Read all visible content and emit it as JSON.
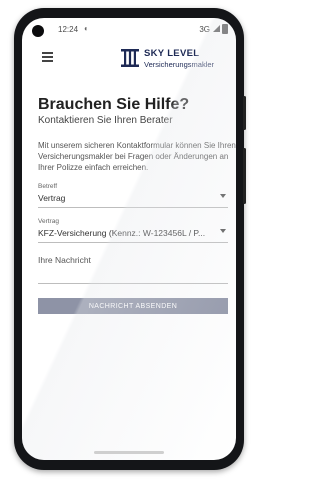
{
  "status_bar": {
    "time": "12:24",
    "network": "3G"
  },
  "header": {
    "brand_name": "SKY LEVEL",
    "brand_tagline": "Versicherungsmakler",
    "menu_icon": "hamburger-menu-icon"
  },
  "main": {
    "title": "Brauchen Sie Hilfe?",
    "subtitle": "Kontaktieren Sie Ihren Berater",
    "intro": "Mit unserem sicheren Kontaktformular können Sie Ihren Versicherungsmakler bei Fragen oder Änderungen an Ihrer Polizze einfach erreichen.",
    "fields": {
      "subject": {
        "label": "Betreff",
        "value": "Vertrag"
      },
      "contract": {
        "label": "Vertrag",
        "value": "KFZ-Versicherung (Kennz.: W-123456L / P..."
      },
      "message": {
        "placeholder": "Ihre Nachricht"
      }
    },
    "submit_label": "NACHRICHT ABSENDEN"
  },
  "colors": {
    "brand": "#1e2a55",
    "button": "#8e93a6"
  }
}
